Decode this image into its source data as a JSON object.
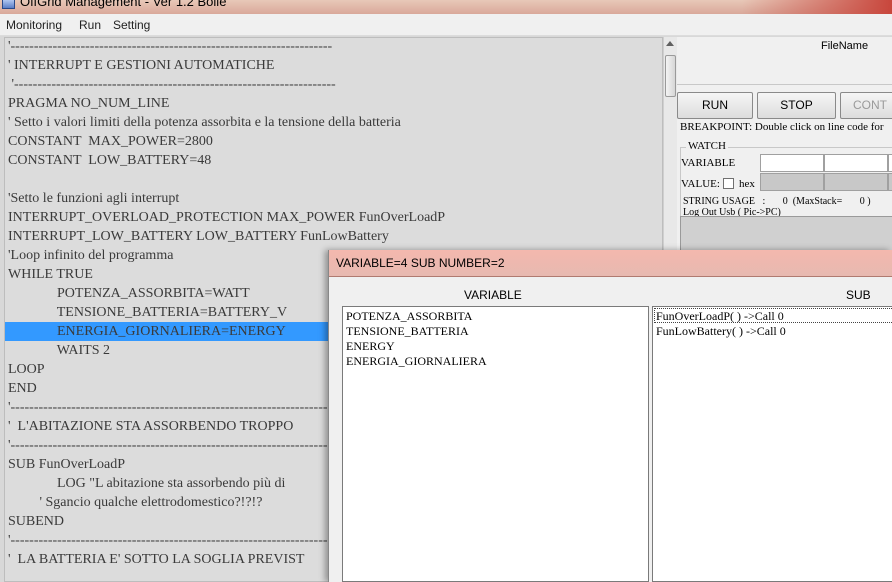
{
  "window": {
    "title": "OffGrid Management - Ver 1.2 Bolle",
    "app_icon": "app-icon"
  },
  "menu": [
    {
      "label": "Monitoring"
    },
    {
      "label": "Run"
    },
    {
      "label": "Setting"
    }
  ],
  "editor": {
    "highlighted_line_index": 15,
    "lines": [
      "'---------------------------------------------------------------------",
      "' INTERRUPT E GESTIONI AUTOMATICHE",
      " '---------------------------------------------------------------------",
      "PRAGMA NO_NUM_LINE",
      "' Setto i valori limiti della potenza assorbita e la tensione della batteria",
      "CONSTANT  MAX_POWER=2800",
      "CONSTANT  LOW_BATTERY=48",
      "",
      "'Setto le funzioni agli interrupt",
      "INTERRUPT_OVERLOAD_PROTECTION MAX_POWER FunOverLoadP",
      "INTERRUPT_LOW_BATTERY LOW_BATTERY FunLowBattery",
      "'Loop infinito del programma",
      "WHILE TRUE",
      "              POTENZA_ASSORBITA=WATT",
      "              TENSIONE_BATTERIA=BATTERY_V",
      "              ENERGIA_GIORNALIERA=ENERGY",
      "              WAITS 2",
      "LOOP",
      "END",
      "'---------------------------------------------------------------------",
      "'  L'ABITAZIONE STA ASSORBENDO TROPPO",
      "'---------------------------------------------------------------------",
      "SUB FunOverLoadP",
      "              LOG \"L abitazione sta assorbendo più di",
      "         ' Sgancio qualche elettrodomestico?!?!?",
      "SUBEND",
      "'---------------------------------------------------------------------",
      "'  LA BATTERIA E' SOTTO LA SOGLIA PREVIST"
    ]
  },
  "panel": {
    "filename_label": "FileName",
    "buttons": {
      "run": "RUN",
      "stop": "STOP",
      "cont": "CONT"
    },
    "breakpoint_hint": "BREAKPOINT: Double click on line code for",
    "watch": {
      "title": "WATCH",
      "variable_label": "VARIABLE",
      "value_label": "VALUE:",
      "hex_label": "hex"
    },
    "string_usage": "STRING USAGE   :       0  (MaxStack=       0 )",
    "log_label": "Log  Out Usb ( Pic->PC)"
  },
  "dialog": {
    "title": "VARIABLE=4 SUB NUMBER=2",
    "variable_header": "VARIABLE",
    "sub_header": "SUB",
    "variables": [
      "POTENZA_ASSORBITA",
      "TENSIONE_BATTERIA",
      "ENERGY",
      "ENERGIA_GIORNALIERA"
    ],
    "subs": [
      "FunOverLoadP( ) ->Call 0",
      "FunLowBattery( ) ->Call 0"
    ]
  }
}
